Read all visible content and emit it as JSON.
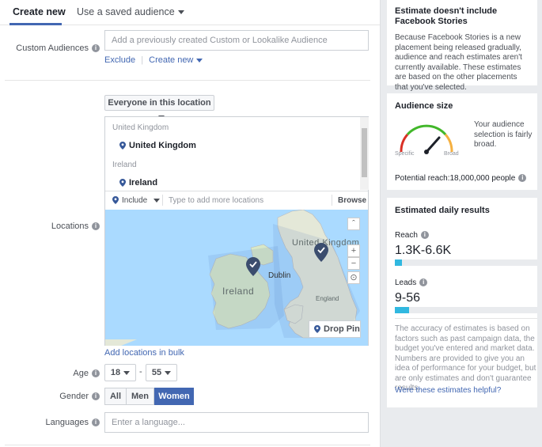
{
  "tabs": {
    "active": "Create new",
    "saved": "Use a saved audience"
  },
  "custom_audiences": {
    "label": "Custom Audiences",
    "placeholder": "Add a previously created Custom or Lookalike Audience",
    "exclude_link": "Exclude",
    "separator": "|",
    "create_new_link": "Create new"
  },
  "locations": {
    "label": "Locations",
    "dropdown": "Everyone in this location",
    "groups": [
      {
        "group": "United Kingdom",
        "item": "United Kingdom"
      },
      {
        "group": "Ireland",
        "item": "Ireland"
      }
    ],
    "include_label": "Include",
    "search_placeholder": "Type to add more locations",
    "browse": "Browse",
    "map_labels": {
      "united_kingdom": "United Kingdom",
      "ireland": "Ireland",
      "dublin": "Dublin",
      "england": "England"
    },
    "drop_pin": "Drop Pin",
    "add_bulk": "Add locations in bulk",
    "zoom_in": "+",
    "zoom_out": "−",
    "collapse": "ˆ"
  },
  "age": {
    "label": "Age",
    "min": "18",
    "dash": "-",
    "max": "55"
  },
  "gender": {
    "label": "Gender",
    "options": [
      "All",
      "Men",
      "Women"
    ],
    "selected": "Women"
  },
  "languages": {
    "label": "Languages",
    "placeholder": "Enter a language..."
  },
  "sidebar": {
    "stories_notice": {
      "title": "Estimate doesn't include Facebook Stories",
      "text": "Because Facebook Stories is a new placement being released gradually, audience and reach estimates aren't currently available. These estimates are based on the other placements that you've selected."
    },
    "audience_size": {
      "title": "Audience size",
      "description": "Your audience selection is fairly broad.",
      "specific": "Specific",
      "broad": "Broad",
      "potential_reach": "Potential reach:18,000,000 people"
    },
    "daily_results": {
      "title": "Estimated daily results",
      "reach_label": "Reach",
      "reach_value": "1.3K-6.6K",
      "reach_fill": 0.05,
      "leads_label": "Leads",
      "leads_value": "9-56",
      "leads_fill": 0.1,
      "disclaimer": "The accuracy of estimates is based on factors such as past campaign data, the budget you've entered and market data. Numbers are provided to give you an idea of performance for your budget, but are only estimates and don't guarantee results.",
      "helpful_link": "Were these estimates helpful?"
    }
  },
  "colors": {
    "accent": "#4267b2",
    "bar": "#31b8e0",
    "pin": "#365899"
  }
}
